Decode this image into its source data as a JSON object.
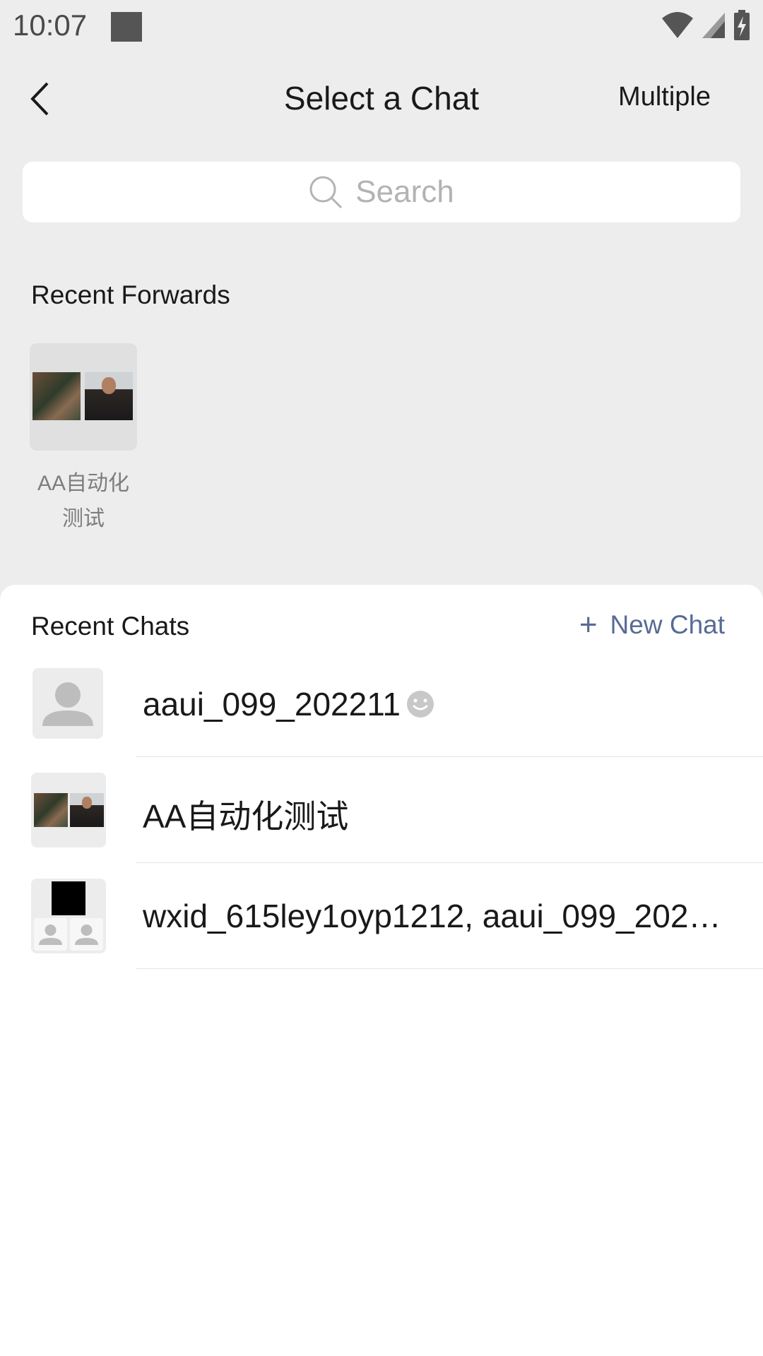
{
  "status_bar": {
    "time": "10:07"
  },
  "header": {
    "title": "Select a Chat",
    "multiple_label": "Multiple"
  },
  "search": {
    "placeholder": "Search"
  },
  "recent_forwards": {
    "title": "Recent Forwards",
    "items": [
      {
        "label": "AA自动化\n测试",
        "label_line1": "AA自动化",
        "label_line2": "测试"
      }
    ]
  },
  "recent_chats": {
    "title": "Recent Chats",
    "new_chat_label": "New Chat",
    "items": [
      {
        "name": "aaui_099_202211"
      },
      {
        "name": "AA自动化测试"
      },
      {
        "name": "wxid_615ley1oyp1212, aaui_099_2022…"
      }
    ]
  },
  "colors": {
    "background": "#ededed",
    "link_accent": "#576b95",
    "placeholder": "#b3b3b3"
  }
}
